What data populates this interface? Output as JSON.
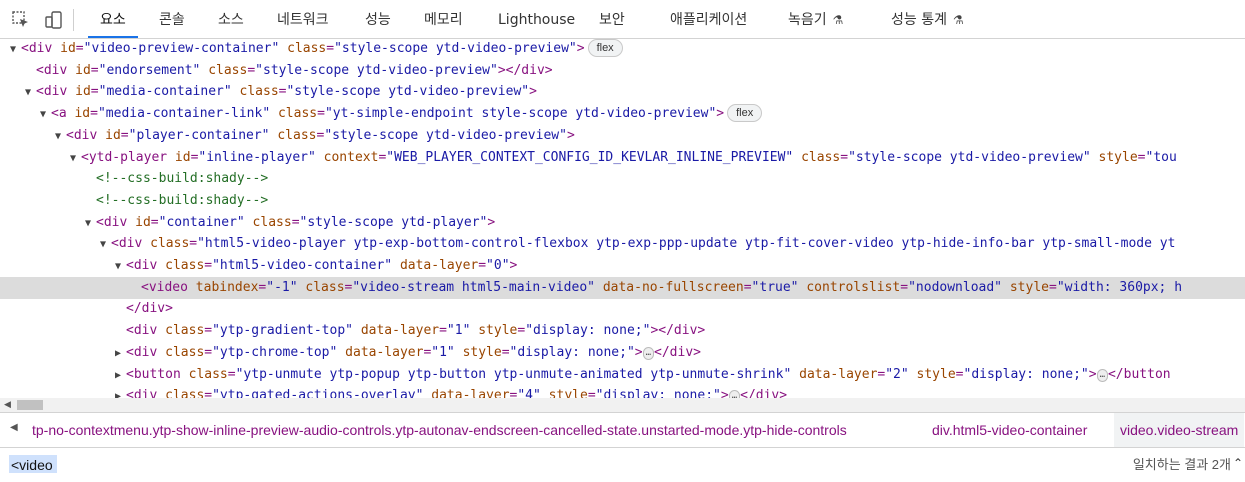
{
  "toolbar": {
    "inspect_icon": "inspect-element-icon",
    "device_icon": "device-toolbar-icon",
    "tabs": [
      {
        "label": "요소",
        "active": true
      },
      {
        "label": "콘솔"
      },
      {
        "label": "소스"
      },
      {
        "label": "네트워크"
      },
      {
        "label": "성능"
      },
      {
        "label": "메모리"
      },
      {
        "label": "Lighthouse"
      },
      {
        "label": "보안"
      },
      {
        "label": "애플리케이션"
      },
      {
        "label": "녹음기",
        "experimental": true
      },
      {
        "label": "성능 통계",
        "experimental": true
      }
    ]
  },
  "dom": {
    "lines": [
      {
        "text": "<div id=\"video-preview-container\" class=\"style-scope ytd-video-preview\">",
        "badge": "flex"
      },
      {
        "text": "<div id=\"endorsement\" class=\"style-scope ytd-video-preview\"></div>"
      },
      {
        "text": "<div id=\"media-container\" class=\"style-scope ytd-video-preview\">"
      },
      {
        "text": "<a id=\"media-container-link\" class=\"yt-simple-endpoint style-scope ytd-video-preview\">",
        "badge": "flex"
      },
      {
        "text": "<div id=\"player-container\" class=\"style-scope ytd-video-preview\">"
      },
      {
        "text": "<ytd-player id=\"inline-player\" context=\"WEB_PLAYER_CONTEXT_CONFIG_ID_KEVLAR_INLINE_PREVIEW\" class=\"style-scope ytd-video-preview\" style=\"tou"
      },
      {
        "text": "<!--css-build:shady-->"
      },
      {
        "text": "<!--css-build:shady-->"
      },
      {
        "text": "<div id=\"container\" class=\"style-scope ytd-player\">"
      },
      {
        "text": "<div class=\"html5-video-player ytp-exp-bottom-control-flexbox ytp-exp-ppp-update ytp-fit-cover-video ytp-hide-info-bar ytp-small-mode yt"
      },
      {
        "text": "<div class=\"html5-video-container\" data-layer=\"0\">"
      },
      {
        "text": "<video tabindex=\"-1\" class=\"video-stream html5-main-video\" data-no-fullscreen=\"true\" controlslist=\"nodownload\" style=\"width: 360px; h"
      },
      {
        "text": "</div>"
      },
      {
        "text": "<div class=\"ytp-gradient-top\" data-layer=\"1\" style=\"display: none;\"></div>"
      },
      {
        "text": "<div class=\"ytp-chrome-top\" data-layer=\"1\" style=\"display: none;\">",
        "ellipsis": "…",
        "after": "</div>"
      },
      {
        "text": "<button class=\"ytp-unmute ytp-popup ytp-button ytp-unmute-animated ytp-unmute-shrink\" data-layer=\"2\" style=\"display: none;\">",
        "ellipsis": "…",
        "after": "</button"
      },
      {
        "text": "<div class=\"ytp-gated-actions-overlay\" data-layer=\"4\" style=\"display: none;\">",
        "ellipsis": "…",
        "after": "</div>"
      }
    ]
  },
  "breadcrumbs": [
    "tp-no-contextmenu.ytp-show-inline-preview-audio-controls.ytp-autonav-endscreen-cancelled-state.unstarted-mode.ytp-hide-controls",
    "div.html5-video-container",
    "video.video-stream"
  ],
  "search": {
    "value": "<video",
    "match_text": "일치하는 결과 2개"
  },
  "colors": {
    "tag": "#881280",
    "attr_name": "#994500",
    "attr_value": "#1a1aa6",
    "comment": "#236e25",
    "selected_row": "#dcdcdc",
    "active_tab_underline": "#1a73e8"
  }
}
